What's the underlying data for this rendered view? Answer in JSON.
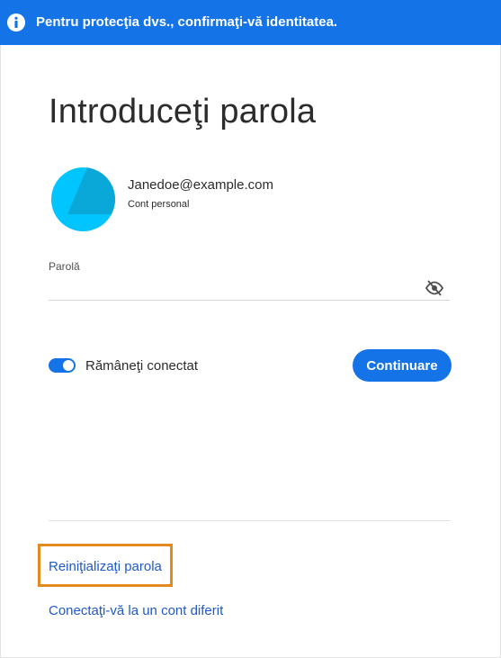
{
  "banner": {
    "icon": "info-icon",
    "text": "Pentru protecţia dvs., confirmaţi-vă identitatea.",
    "color": "#1473e6"
  },
  "page": {
    "title": "Introduceţi parola"
  },
  "account": {
    "avatar_icon": "avatar-icon",
    "avatar_color": "#00c5ff",
    "email": "Janedoe@example.com",
    "type": "Cont personal"
  },
  "password": {
    "label": "Parolă",
    "value": "",
    "visibility_icon": "eye-slash-icon"
  },
  "stay_signed_in": {
    "label": "Rămâneţi conectat",
    "enabled": true
  },
  "actions": {
    "continue_label": "Continuare",
    "accent": "#1473e6"
  },
  "links": {
    "reset_password": "Reiniţializaţi parola",
    "other_account": "Conectaţi-vă la un cont diferit",
    "highlight_color": "#e28a1d"
  }
}
